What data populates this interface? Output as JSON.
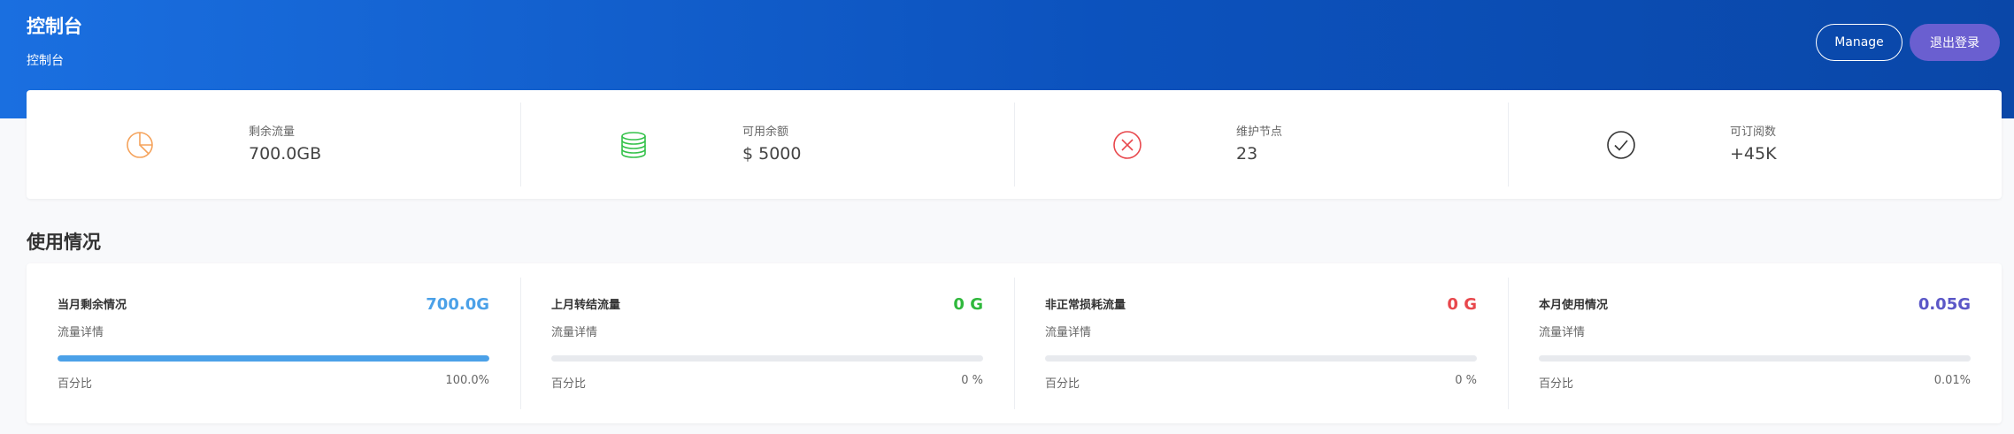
{
  "header": {
    "title": "控制台",
    "subtitle": "控制台",
    "manage_label": "Manage",
    "logout_label": "退出登录"
  },
  "stats": [
    {
      "label": "剩余流量",
      "value": "700.0GB",
      "icon": "pie-chart-icon",
      "color": "#f5a35c"
    },
    {
      "label": "可用余额",
      "value": "$ 5000",
      "icon": "coins-icon",
      "color": "#34c24a"
    },
    {
      "label": "维护节点",
      "value": "23",
      "icon": "x-circle-icon",
      "color": "#e8474c"
    },
    {
      "label": "可订阅数",
      "value": "+45K",
      "icon": "check-circle-icon",
      "color": "#333333"
    }
  ],
  "usage": {
    "title": "使用情况",
    "items": [
      {
        "title": "当月剩余情况",
        "value": "700.0G",
        "value_color": "#4ba1e8",
        "detail": "流量详情",
        "percent_label": "百分比",
        "percent": "100.0%",
        "fill": 1.0
      },
      {
        "title": "上月转结流量",
        "value": "0 G",
        "value_color": "#2fb83c",
        "detail": "流量详情",
        "percent_label": "百分比",
        "percent": "0 %",
        "fill": 0
      },
      {
        "title": "非正常损耗流量",
        "value": "0 G",
        "value_color": "#e8474c",
        "detail": "流量详情",
        "percent_label": "百分比",
        "percent": "0 %",
        "fill": 0
      },
      {
        "title": "本月使用情况",
        "value": "0.05G",
        "value_color": "#5b57c7",
        "detail": "流量详情",
        "percent_label": "百分比",
        "percent": "0.01%",
        "fill": 0.0001
      }
    ]
  }
}
